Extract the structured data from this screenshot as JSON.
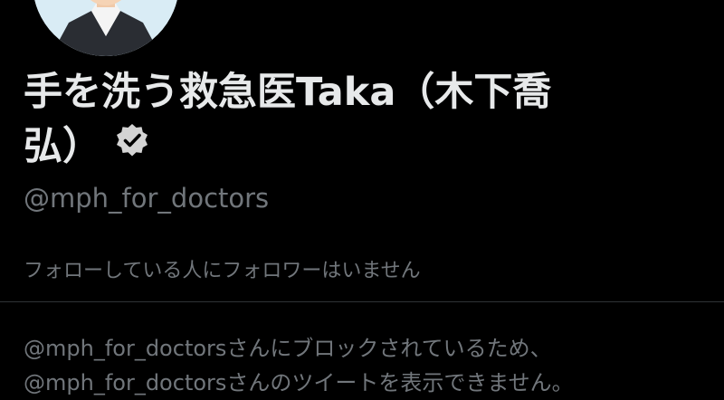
{
  "profile": {
    "display_name_line1": "手を洗う救急医Taka（木下喬",
    "display_name_line2": "弘）",
    "verified_icon": "verified-badge-icon",
    "handle": "@mph_for_doctors",
    "followers_you_know": "フォローしている人にフォロワーはいません"
  },
  "blocked_notice": {
    "line1": "@mph_for_doctorsさんにブロックされているため、",
    "line2": "@mph_for_doctorsさんのツイートを表示できません。"
  },
  "colors": {
    "background": "#000000",
    "primary_text": "#e7e9ea",
    "secondary_text": "#71767b",
    "divider": "#2f3336"
  }
}
